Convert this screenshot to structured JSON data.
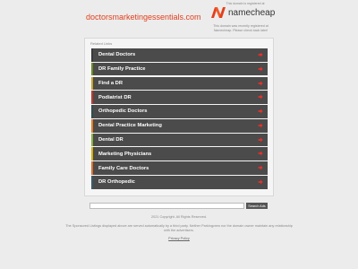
{
  "header": {
    "domain": "doctorsmarketingessentials.com",
    "registrar_note": "This domain is registered at",
    "registrar_name": "namecheap",
    "registrar_description": "This domain was recently registered at Namecheap. Please check back later!",
    "logo_color": "#e2401c"
  },
  "panel": {
    "title": "Related Links",
    "item_background": "#4b4b4b",
    "arrow_color": "#e8302a",
    "items": [
      {
        "label": "Dental Doctors",
        "accent": "#3a3a3a"
      },
      {
        "label": "DR Family Practice",
        "accent": "#6b8e23"
      },
      {
        "label": "Find a DR",
        "accent": "#c9a227"
      },
      {
        "label": "Podiatrist DR",
        "accent": "#c0392b"
      },
      {
        "label": "Orthopedic Doctors",
        "accent": "#2f4f4f"
      },
      {
        "label": "Dental Practice Marketing",
        "accent": "#e67e22"
      },
      {
        "label": "Dental DR",
        "accent": "#8ab33f"
      },
      {
        "label": "Marketing Physicians",
        "accent": "#d4b106"
      },
      {
        "label": "Family Care Doctors",
        "accent": "#e06f2c"
      },
      {
        "label": "DR Orthopedic",
        "accent": "#3b5b6b"
      }
    ]
  },
  "search": {
    "placeholder": "",
    "button_label": "Search Ads"
  },
  "footer": {
    "copyright": "2021 Copyright. All Rights Reserved.",
    "disclaimer": "The Sponsored Listings displayed above are served automatically by a third party. Neither Parkingcrew nor the domain owner maintain any relationship with the advertisers.",
    "privacy_label": "Privacy Policy"
  }
}
